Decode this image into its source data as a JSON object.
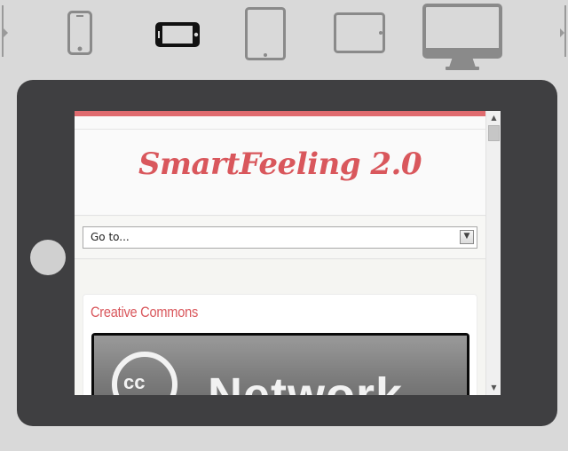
{
  "toolbar": {
    "devices": [
      {
        "name": "smartphone-portrait",
        "icon": "smartphone-portrait-icon",
        "selected": false
      },
      {
        "name": "smartphone-landscape",
        "icon": "smartphone-landscape-icon",
        "selected": true
      },
      {
        "name": "tablet-portrait",
        "icon": "tablet-portrait-icon",
        "selected": false
      },
      {
        "name": "tablet-landscape",
        "icon": "tablet-landscape-icon",
        "selected": false
      },
      {
        "name": "desktop",
        "icon": "desktop-monitor-icon",
        "selected": false
      }
    ],
    "prev_icon": "arrow-left-icon",
    "next_icon": "arrow-right-icon"
  },
  "site": {
    "title": "SmartFeeling 2.0",
    "nav_select_value": "Go to...",
    "widget_title": "Creative Commons",
    "badge_circle_text": "cc",
    "badge_text": "Network"
  },
  "colors": {
    "accent": "#e06b6f",
    "title": "#d9575c",
    "frame": "#3f3f41",
    "background": "#d9d9d9"
  }
}
